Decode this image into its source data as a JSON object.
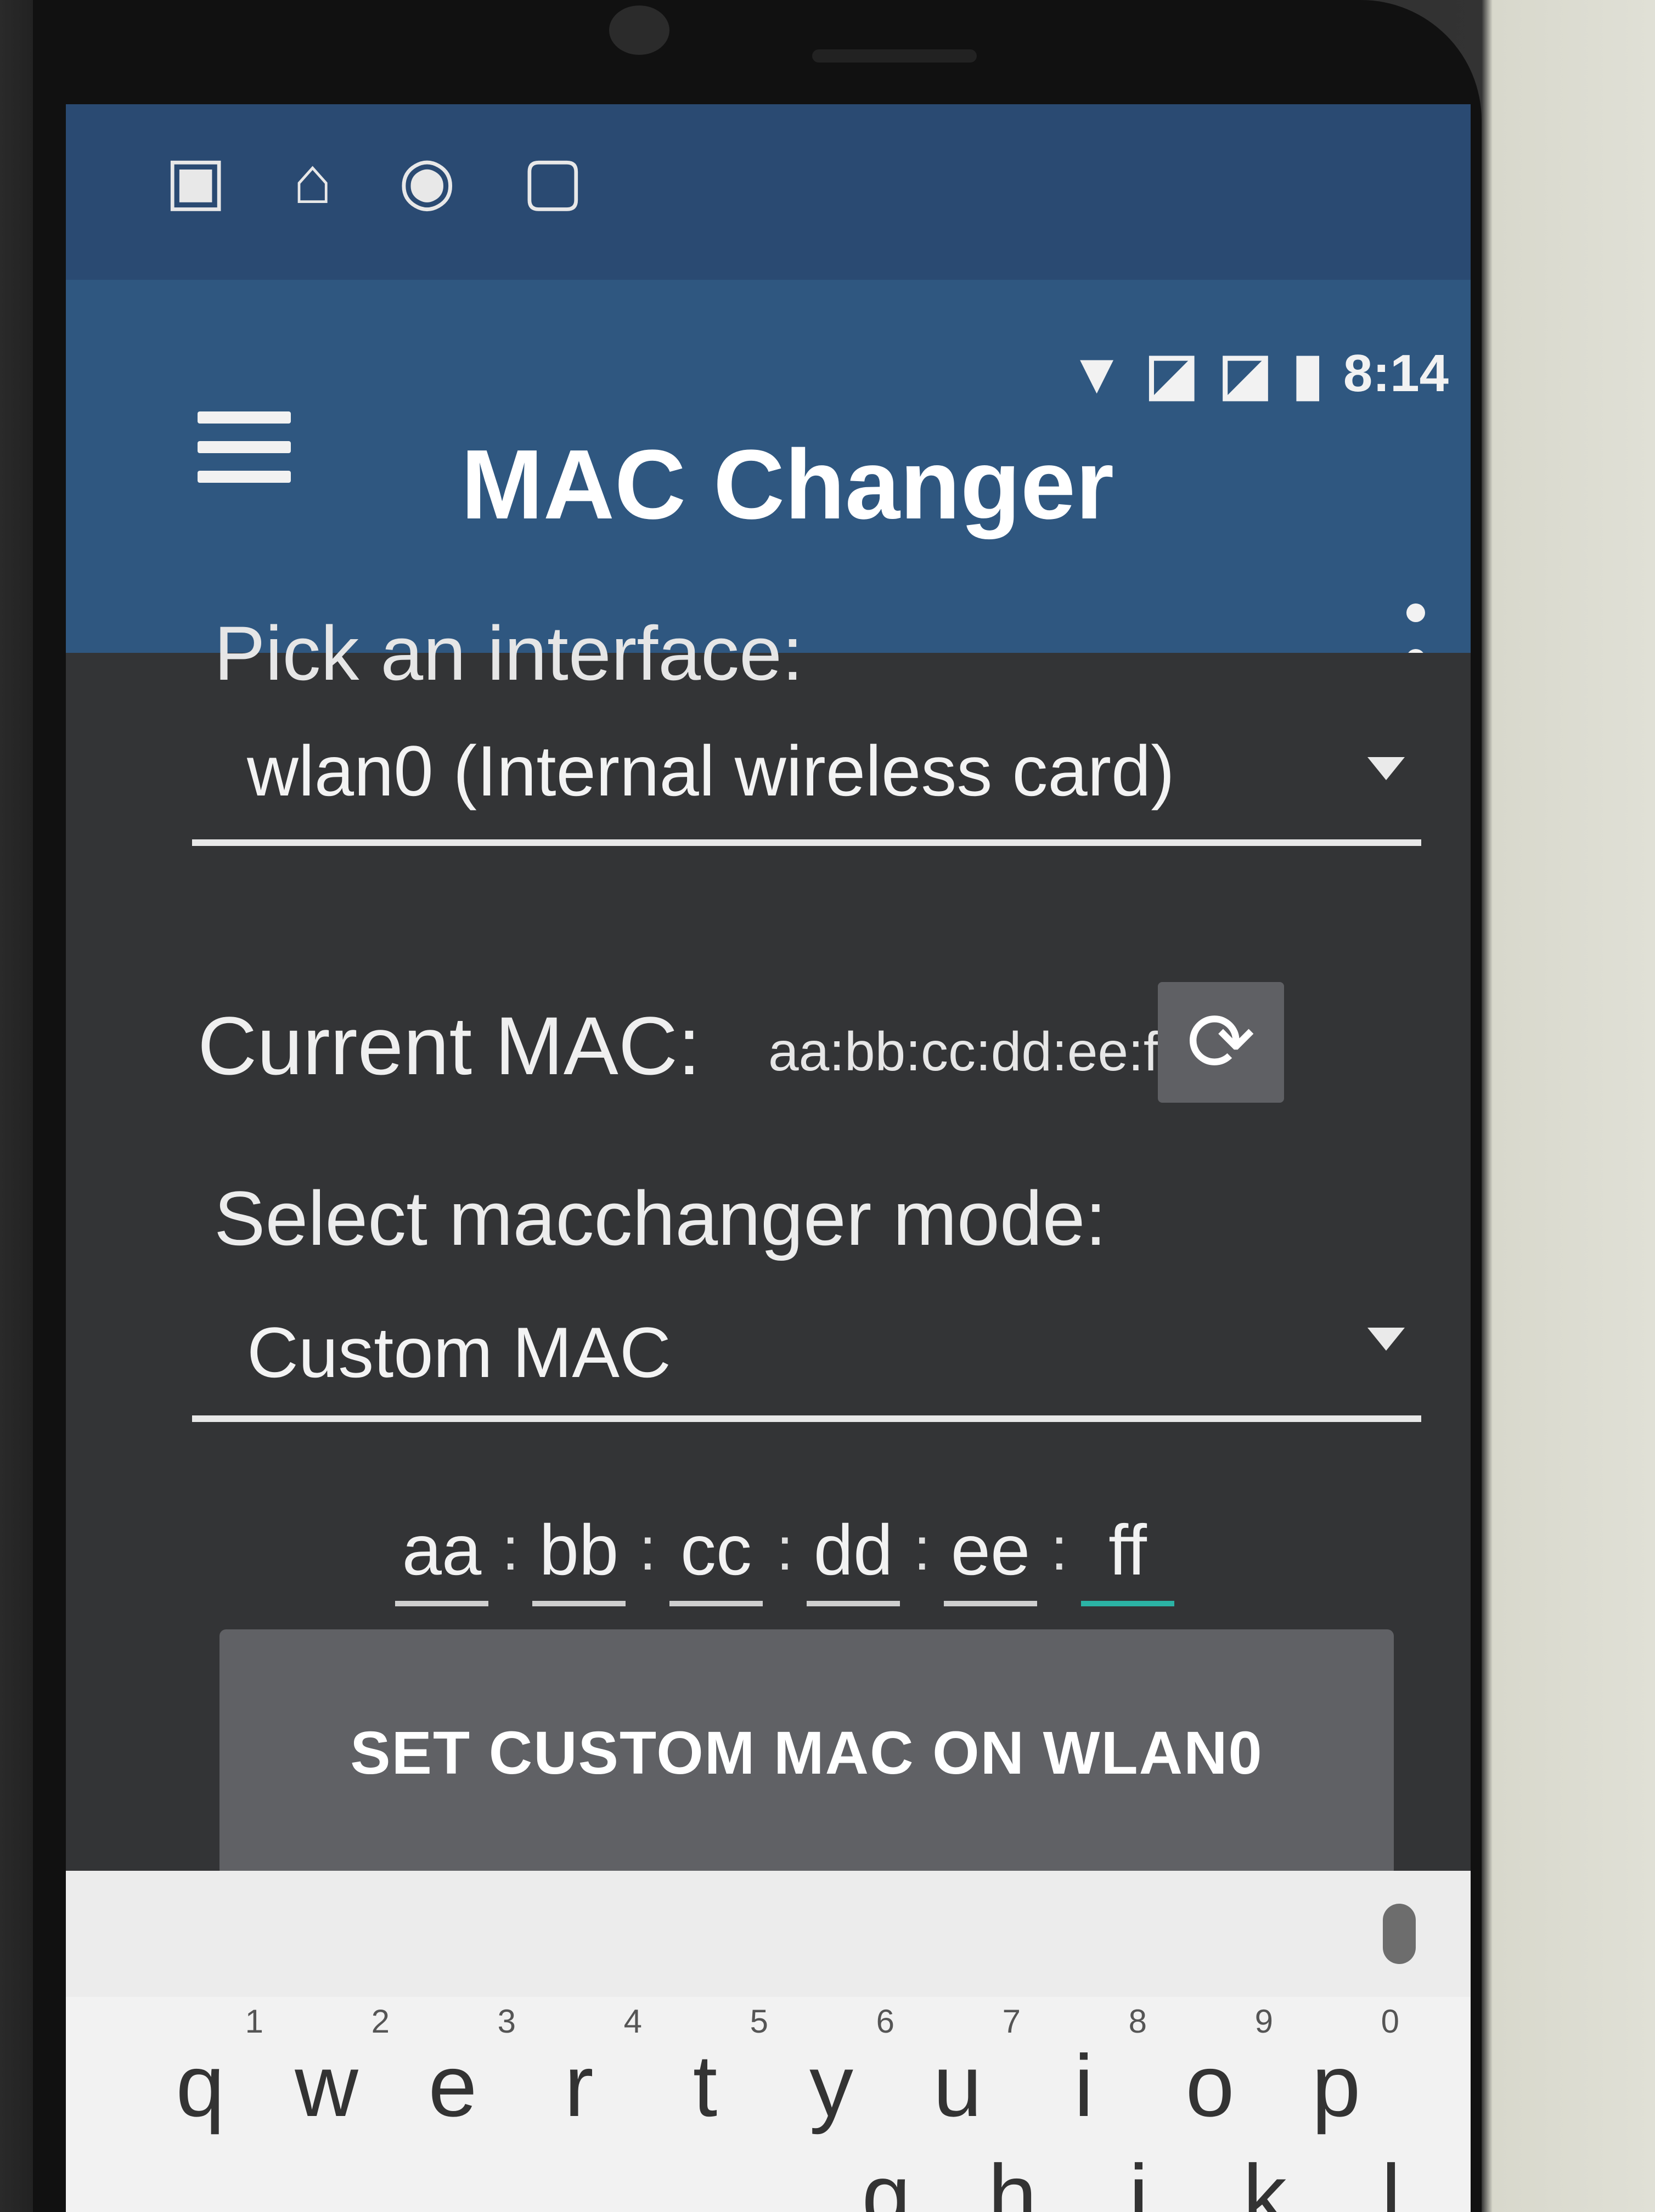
{
  "status_bar": {
    "left_icons": [
      "sim-card-icon",
      "notification-icon",
      "owl-icon",
      "screenshot-icon"
    ],
    "time": "8:14",
    "right_icons": [
      "wifi-icon",
      "no-sim-icon",
      "no-sim-icon",
      "battery-icon"
    ]
  },
  "app_bar": {
    "title": "MAC Changer"
  },
  "interface": {
    "label": "Pick an interface:",
    "selected": "wlan0 (Internal wireless card)"
  },
  "current_mac": {
    "label": "Current MAC:",
    "value": "aa:bb:cc:dd:ee:ff"
  },
  "mode": {
    "label": "Select macchanger mode:",
    "selected": "Custom MAC"
  },
  "custom_mac": {
    "octets": [
      "aa",
      "bb",
      "cc",
      "dd",
      "ee",
      "ff"
    ],
    "separator": ":"
  },
  "set_button": {
    "label": "SET CUSTOM MAC ON WLAN0"
  },
  "keyboard": {
    "row1": [
      {
        "ch": "q",
        "num": "1"
      },
      {
        "ch": "w",
        "num": "2"
      },
      {
        "ch": "e",
        "num": "3"
      },
      {
        "ch": "r",
        "num": "4"
      },
      {
        "ch": "t",
        "num": "5"
      },
      {
        "ch": "y",
        "num": "6"
      },
      {
        "ch": "u",
        "num": "7"
      },
      {
        "ch": "i",
        "num": "8"
      },
      {
        "ch": "o",
        "num": "9"
      },
      {
        "ch": "p",
        "num": "0"
      }
    ],
    "row2": [
      "g",
      "h",
      "j",
      "k",
      "l"
    ]
  },
  "colors": {
    "app_bar": "#2f5780",
    "background": "#333436",
    "accent_underline": "#2bb3a5",
    "button": "#606165"
  }
}
